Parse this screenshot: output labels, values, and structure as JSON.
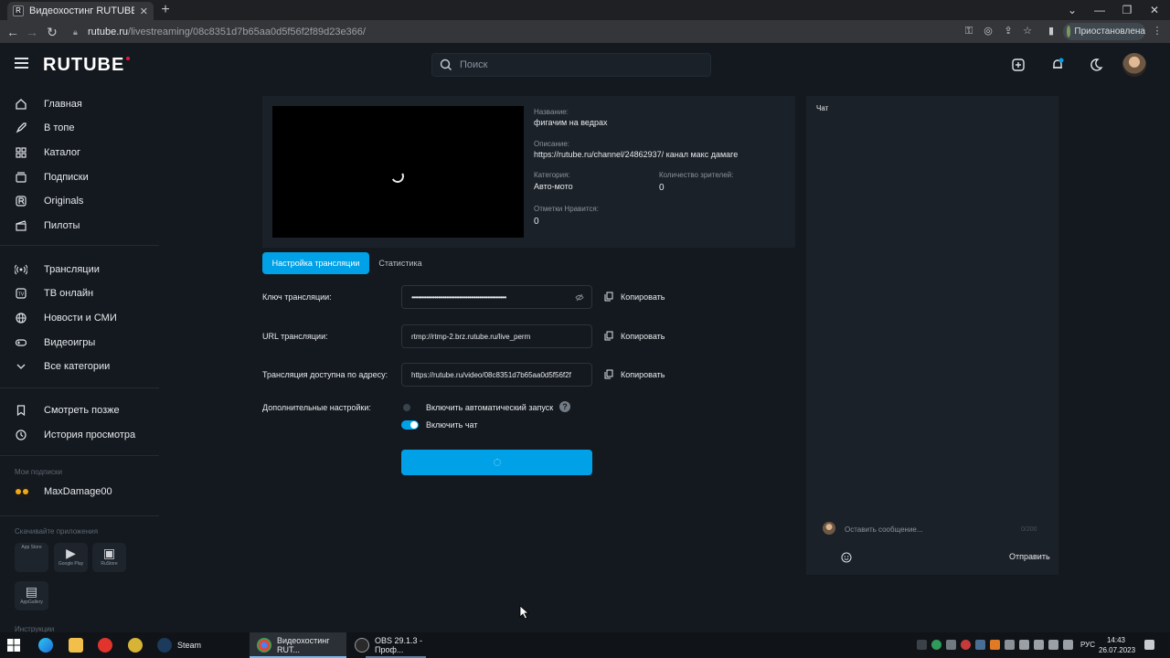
{
  "browser": {
    "tab_title": "Видеохостинг RUTUBE. Смотрите...",
    "tab_favicon": "R",
    "url_host": "rutube.ru",
    "url_path": "/livestreaming/08c8351d7b65aa0d5f56f2f89d23e366/",
    "profile_status": "Приостановлена"
  },
  "header": {
    "logo": "RUTUBE",
    "search_placeholder": "Поиск"
  },
  "sidebar": {
    "items": [
      {
        "label": "Главная",
        "icon": "home-icon"
      },
      {
        "label": "В топе",
        "icon": "rocket-icon"
      },
      {
        "label": "Каталог",
        "icon": "grid-icon"
      },
      {
        "label": "Подписки",
        "icon": "subscriptions-icon"
      },
      {
        "label": "Originals",
        "icon": "originals-icon"
      },
      {
        "label": "Пилоты",
        "icon": "clapper-icon"
      }
    ],
    "items2": [
      {
        "label": "Трансляции",
        "icon": "broadcast-icon"
      },
      {
        "label": "ТВ онлайн",
        "icon": "tv-icon"
      },
      {
        "label": "Новости и СМИ",
        "icon": "globe-icon"
      },
      {
        "label": "Видеоигры",
        "icon": "gamepad-icon"
      },
      {
        "label": "Все категории",
        "icon": "chevron-down-icon"
      }
    ],
    "items3": [
      {
        "label": "Смотреть позже",
        "icon": "bookmark-icon"
      },
      {
        "label": "История просмотра",
        "icon": "history-icon"
      }
    ],
    "subs_caption": "Мои подписки",
    "subscription": "MaxDamage00",
    "apps_caption": "Скачивайте приложения",
    "apps": [
      {
        "label": "App Store",
        "icon": "apple-icon"
      },
      {
        "label": "Google Play",
        "icon": "google-play-icon"
      },
      {
        "label": "RuStore",
        "icon": "rustore-icon"
      },
      {
        "label": "AppGallery",
        "icon": "appgallery-icon"
      }
    ],
    "instructions_caption": "Инструкции"
  },
  "stream": {
    "name_label": "Название:",
    "name": "фигачим на ведрах",
    "desc_label": "Описание:",
    "desc": "https://rutube.ru/channel/24862937/ канал макс дамаге",
    "category_label": "Категория:",
    "category": "Авто-мото",
    "viewers_label": "Количество зрителей:",
    "viewers": "0",
    "likes_label": "Отметки Нравится:",
    "likes": "0"
  },
  "tabs": {
    "settings": "Настройка трансляции",
    "stats": "Статистика"
  },
  "settings": {
    "key_label": "Ключ трансляции:",
    "key_value": "••••••••••••••••••••••••••••••••••••••••••••••••••••••••••",
    "url_label": "URL трансляции:",
    "url_value": "rtmp://rtmp-2.brz.rutube.ru/live_perm",
    "address_label": "Трансляция доступна по адресу:",
    "address_value": "https://rutube.ru/video/08c8351d7b65aa0d5f56f2f",
    "copy_label": "Копировать",
    "extra_label": "Дополнительные настройки:",
    "autostart_label": "Включить автоматический запуск",
    "chat_label": "Включить чат",
    "autostart_on": false,
    "chat_on": true
  },
  "chat": {
    "title": "Чат",
    "placeholder": "Оставить сообщение...",
    "counter": "0/200",
    "send": "Отправить"
  },
  "taskbar": {
    "apps": [
      {
        "label": "Steam"
      },
      {
        "label": "Видеохостинг RUT..."
      },
      {
        "label": "OBS 29.1.3 - Проф..."
      }
    ],
    "lang": "РУС",
    "time": "14:43",
    "date": "26.07.2023"
  },
  "colors": {
    "accent": "#00a1e7",
    "background": "#14191f",
    "card": "#1b2128",
    "logo_dot": "#ed143b"
  }
}
